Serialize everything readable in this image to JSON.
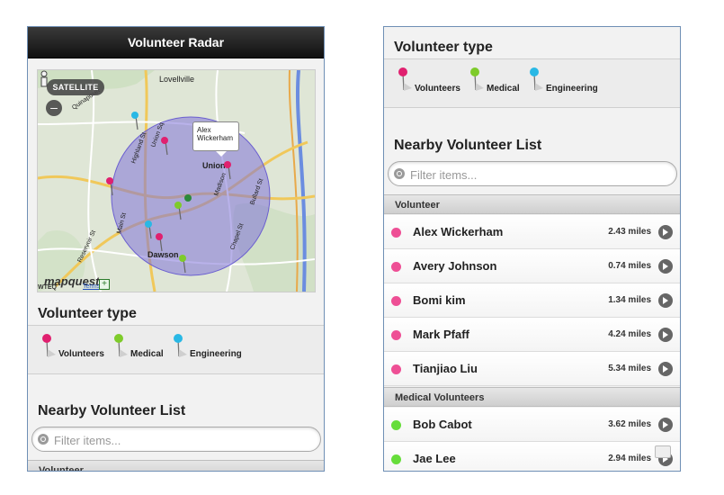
{
  "left": {
    "title": "Volunteer Radar",
    "map": {
      "satellite_label": "SATELLITE",
      "zoom_out_label": "–",
      "place_labels": [
        "Lovellville",
        "Union Sq",
        "Highland St",
        "Union",
        "Main St",
        "Reservoir St",
        "Dawson",
        "Madison",
        "Chapel St",
        "Bullard St",
        "Quinapoxet"
      ],
      "bubble_lines": [
        "Alex",
        "Wickerham"
      ],
      "logo_text": "mapquest",
      "logo_sub": "WTEQ",
      "terms_label": "Terms",
      "plus_label": "+"
    },
    "volunteer_type_title": "Volunteer type",
    "legend": [
      "Volunteers",
      "Medical",
      "Engineering"
    ],
    "nearby_title": "Nearby Volunteer List",
    "filter_placeholder": "Filter items...",
    "group_partial": "Volunteer"
  },
  "right": {
    "volunteer_type_title": "Volunteer type",
    "legend": [
      "Volunteers",
      "Medical",
      "Engineering"
    ],
    "nearby_title": "Nearby Volunteer List",
    "filter_placeholder": "Filter items...",
    "groups": [
      {
        "label": "Volunteer",
        "color": "#ee4f95",
        "rows": [
          {
            "name": "Alex Wickerham",
            "distance": "2.43 miles"
          },
          {
            "name": "Avery Johnson",
            "distance": "0.74 miles"
          },
          {
            "name": "Bomi kim",
            "distance": "1.34 miles"
          },
          {
            "name": "Mark Pfaff",
            "distance": "4.24 miles"
          },
          {
            "name": "Tianjiao Liu",
            "distance": "5.34 miles"
          }
        ]
      },
      {
        "label": "Medical Volunteers",
        "color": "#66dd3a",
        "rows": [
          {
            "name": "Bob Cabot",
            "distance": "3.62 miles"
          },
          {
            "name": "Jae Lee",
            "distance": "2.94 miles"
          }
        ]
      }
    ]
  },
  "colors": {
    "volunteer": "#e0206f",
    "medical": "#7ecb2a",
    "engineering": "#29b8e5",
    "radar": "#7f73d9"
  }
}
